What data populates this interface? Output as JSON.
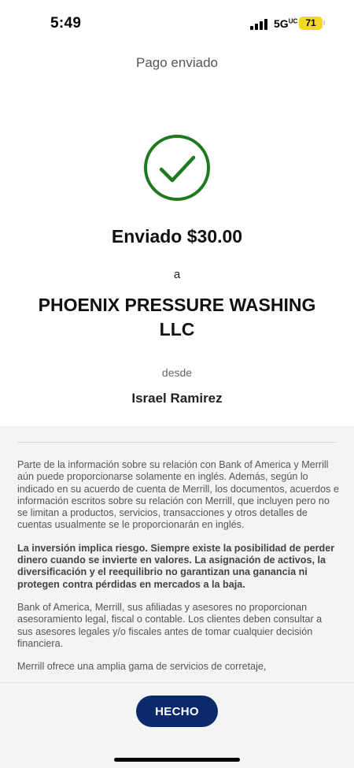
{
  "status_bar": {
    "time": "5:49",
    "network": "5G",
    "network_suffix": "UC",
    "battery_level": "71",
    "icons": [
      "signal-icon",
      "battery-icon"
    ]
  },
  "header": {
    "title": "Pago enviado"
  },
  "confirmation": {
    "icon": "check-circle-icon",
    "icon_color": "#1f7a1f",
    "amount_text": "Enviado $30.00",
    "to_label": "a",
    "payee_name": "PHOENIX PRESSURE WASHING LLC",
    "from_label": "desde",
    "sender_name": "Israel Ramirez"
  },
  "disclosure": {
    "paragraphs": [
      "Parte de la información sobre su relación con Bank of America y Merrill aún puede proporcionarse solamente en inglés. Además, según lo indicado en su acuerdo de cuenta de Merrill, los documentos, acuerdos e información escritos sobre su relación con Merrill, que incluyen pero no se limitan a productos, servicios, transacciones y otros detalles de cuentas usualmente se le proporcionarán en inglés.",
      "La inversión implica riesgo. Siempre existe la posibilidad de perder dinero cuando se invierte en valores. La asignación de activos, la diversificación y el reequilibrio no garantizan una ganancia ni protegen contra pérdidas en mercados a la baja.",
      "Bank of America, Merrill, sus afiliadas y asesores no proporcionan asesoramiento legal, fiscal o contable. Los clientes deben consultar a sus asesores legales y/o fiscales antes de tomar cualquier decisión financiera.",
      "Merrill ofrece una amplia gama de servicios de corretaje,"
    ]
  },
  "footer": {
    "done_label": "HECHO",
    "button_color": "#0a2a6b"
  }
}
